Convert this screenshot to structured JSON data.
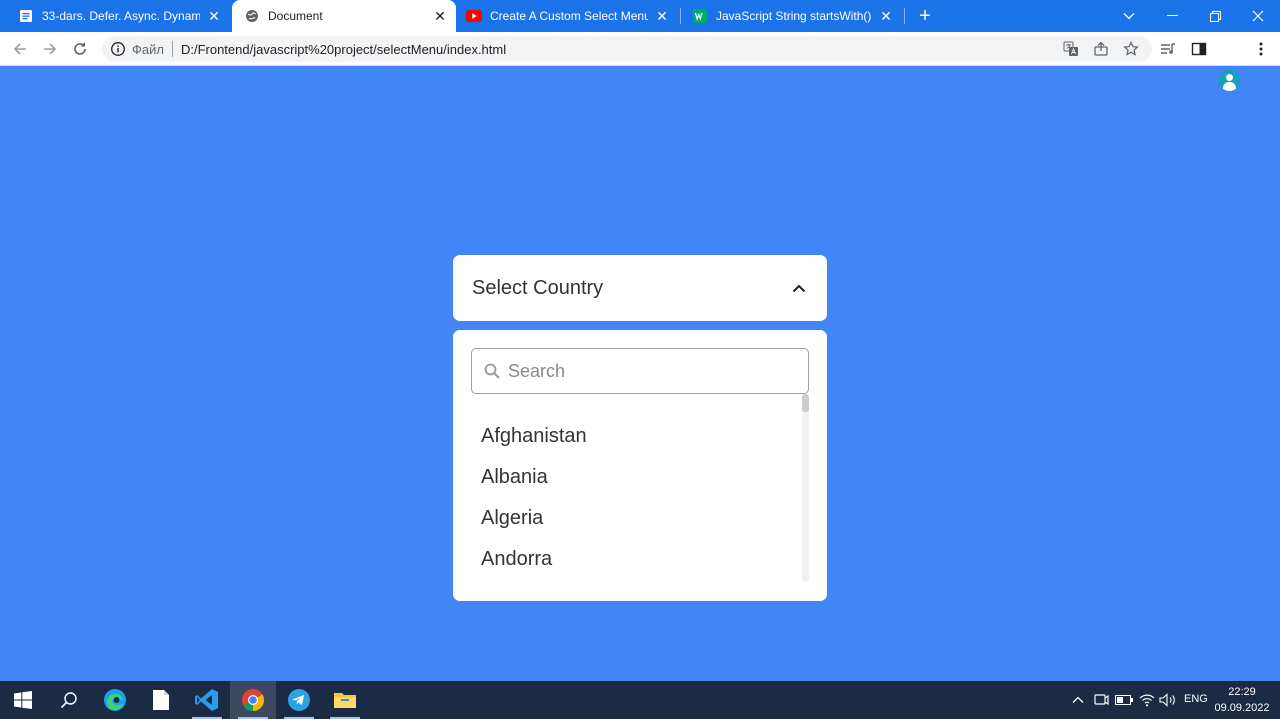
{
  "browser": {
    "tabs": [
      {
        "title": "33-dars. Defer. Async. Dynamic s",
        "icon": "doc-icon",
        "active": false
      },
      {
        "title": "Document",
        "icon": "globe-icon",
        "active": true
      },
      {
        "title": "Create A Custom Select Menu in",
        "icon": "youtube-icon",
        "active": false
      },
      {
        "title": "JavaScript String startsWith() usu",
        "icon": "w3-icon",
        "active": false
      }
    ],
    "new_tab_symbol": "+",
    "address": {
      "scheme_label": "Файл",
      "url": "D:/Frontend/javascript%20project/selectMenu/index.html"
    }
  },
  "page": {
    "select_label": "Select Country",
    "search_placeholder": "Search",
    "options": [
      "Afghanistan",
      "Albania",
      "Algeria",
      "Andorra"
    ]
  },
  "taskbar": {
    "apps": [
      "start-icon",
      "search-icon",
      "edge-icon",
      "notepad-icon",
      "vscode-icon",
      "chrome-icon",
      "telegram-icon",
      "explorer-icon"
    ],
    "language": "ENG",
    "time": "22:29",
    "date": "09.09.2022"
  },
  "colors": {
    "page_background": "#4285f4",
    "chrome_tabstrip": "#1a73e8",
    "taskbar": "#1b2b44"
  }
}
